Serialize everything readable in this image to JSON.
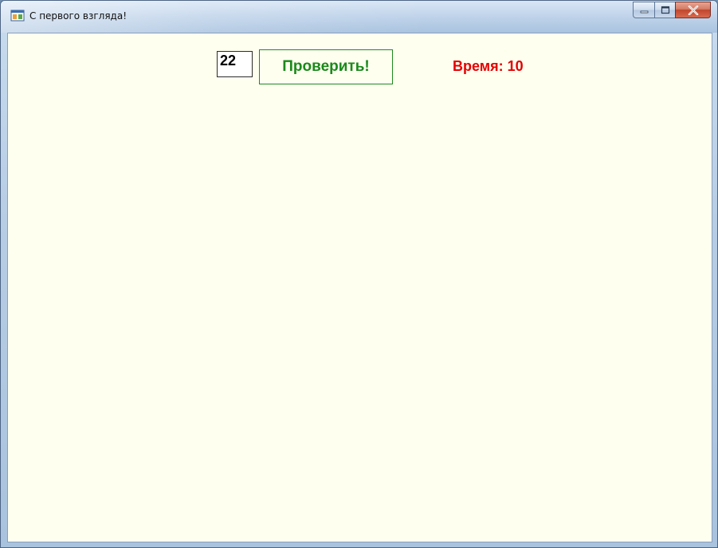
{
  "window": {
    "title": "С первого взгляда!",
    "icon": "app-window-icon"
  },
  "controls": {
    "number_value": "22",
    "check_button_label": "Проверить!",
    "time_label": "Время: 10"
  },
  "colors": {
    "client_background": "#fffff0",
    "button_text": "#1a8a1a",
    "button_border": "#1e8a1e",
    "time_text": "#e40000"
  }
}
